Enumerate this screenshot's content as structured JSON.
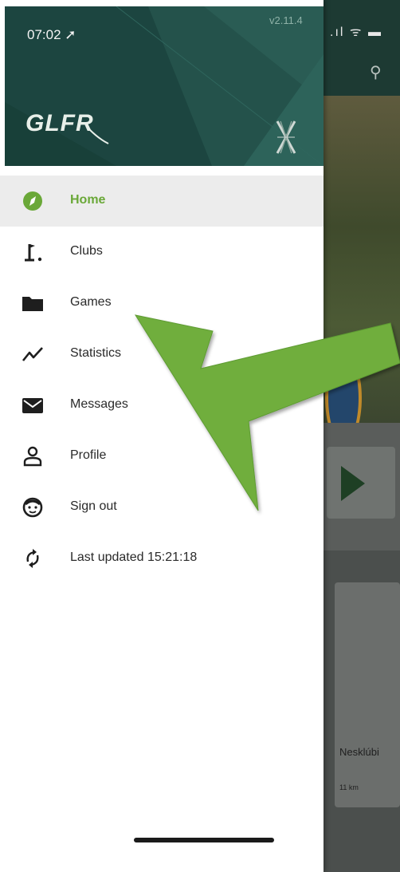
{
  "status_bar": {
    "time": "07:02 ➚",
    "version": "v2.11.4"
  },
  "logo": {
    "text": "GLFR"
  },
  "menu": {
    "items": [
      {
        "label": "Home",
        "icon": "compass-icon",
        "active": true
      },
      {
        "label": "Clubs",
        "icon": "golf-flag-icon",
        "active": false
      },
      {
        "label": "Games",
        "icon": "folder-icon",
        "active": false
      },
      {
        "label": "Statistics",
        "icon": "trend-line-icon",
        "active": false
      },
      {
        "label": "Messages",
        "icon": "envelope-icon",
        "active": false
      },
      {
        "label": "Profile",
        "icon": "person-icon",
        "active": false
      },
      {
        "label": "Sign out",
        "icon": "smiley-face-icon",
        "active": false
      },
      {
        "label": "Last updated 15:21:18",
        "icon": "sync-icon",
        "active": false
      }
    ]
  },
  "background_app": {
    "card_title": "Nesklúbi",
    "card_distance": "11 km"
  },
  "colors": {
    "header_bg": "#1c4540",
    "accent_green": "#6aa838",
    "arrow_green": "#6fae3e"
  }
}
